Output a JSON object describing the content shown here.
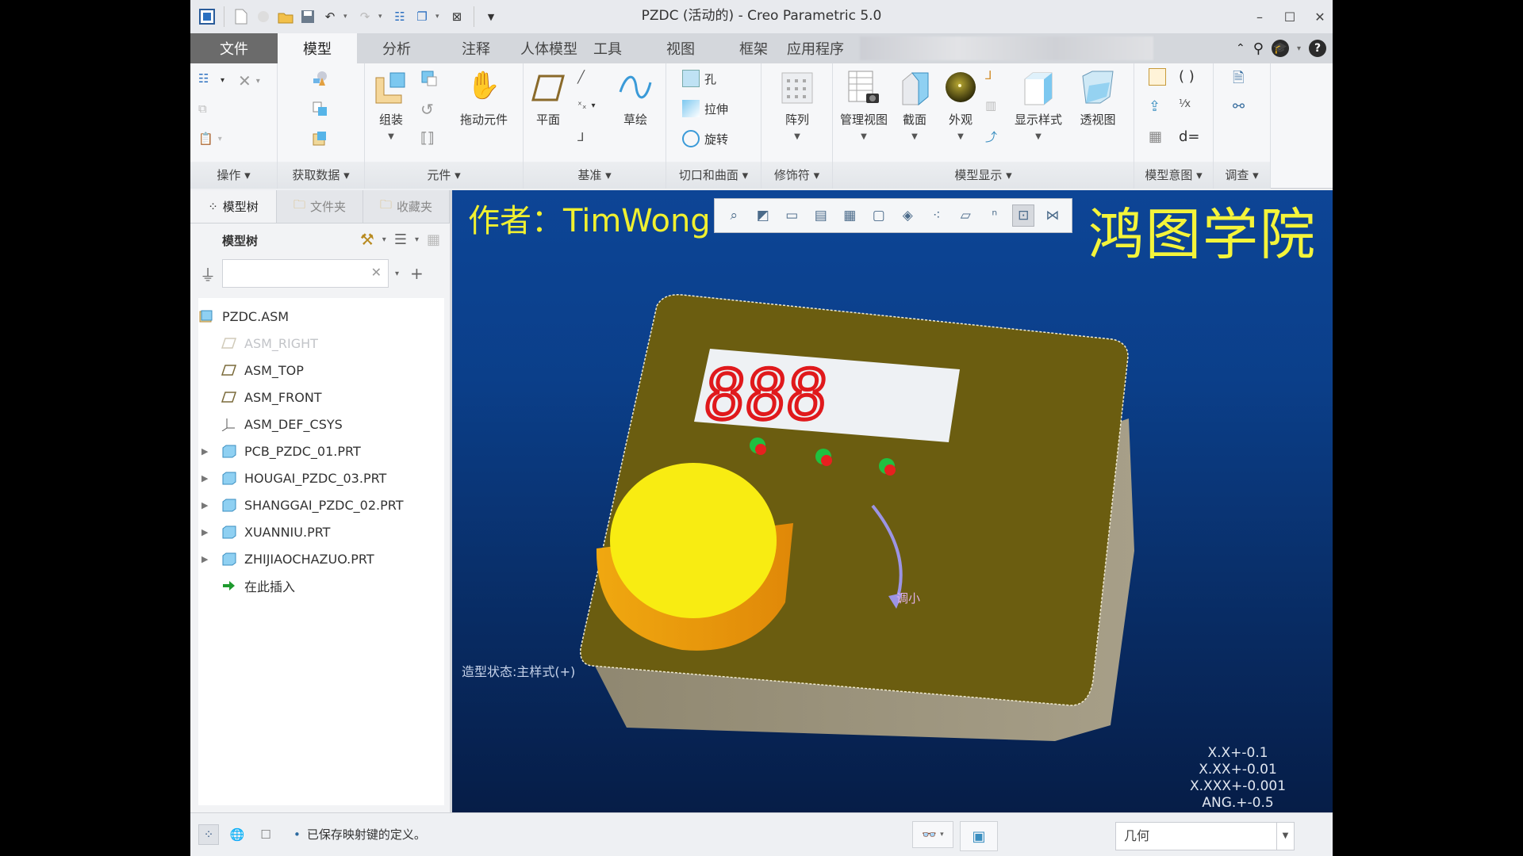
{
  "window": {
    "title": "PZDC (活动的) - Creo Parametric 5.0",
    "controls": {
      "minimize": "–",
      "maximize": "☐",
      "close": "✕"
    }
  },
  "quick_access": [
    "new-icon",
    "open-icon",
    "save-icon",
    "undo-icon",
    "redo-icon",
    "regenerate-icon",
    "windows-icon",
    "close-window-icon",
    "customize-icon"
  ],
  "tabs": [
    {
      "label": "文件"
    },
    {
      "label": "模型",
      "active": true
    },
    {
      "label": "分析"
    },
    {
      "label": "注释"
    },
    {
      "label": "人体模型"
    },
    {
      "label": "工具"
    },
    {
      "label": "视图"
    },
    {
      "label": "框架"
    },
    {
      "label": "应用程序"
    }
  ],
  "ribbon": {
    "groups": {
      "operations": "操作",
      "get_data": "获取数据",
      "component": "元件",
      "datum": "基准",
      "cut_surface": "切口和曲面",
      "modifiers": "修饰符",
      "model_display": "模型显示",
      "model_intent": "模型意图",
      "investigate": "调查"
    },
    "buttons": {
      "assemble": "组装",
      "drag_components": "拖动元件",
      "plane": "平面",
      "sketch": "草绘",
      "hole": "孔",
      "extrude": "拉伸",
      "revolve": "旋转",
      "pattern": "阵列",
      "manage_views": "管理视图",
      "section": "截面",
      "appearance": "外观",
      "display_style": "显示样式",
      "perspective": "透视图",
      "relations": "d="
    }
  },
  "left_panel": {
    "tabs": [
      {
        "label": "模型树",
        "active": true
      },
      {
        "label": "文件夹"
      },
      {
        "label": "收藏夹"
      }
    ],
    "header": "模型树",
    "search": {
      "value": "",
      "placeholder": ""
    },
    "tree": [
      {
        "label": "PZDC.ASM",
        "type": "assembly",
        "level": 0
      },
      {
        "label": "ASM_RIGHT",
        "type": "plane",
        "level": 1,
        "hidden": true
      },
      {
        "label": "ASM_TOP",
        "type": "plane",
        "level": 1
      },
      {
        "label": "ASM_FRONT",
        "type": "plane",
        "level": 1
      },
      {
        "label": "ASM_DEF_CSYS",
        "type": "csys",
        "level": 1
      },
      {
        "label": "PCB_PZDC_01.PRT",
        "type": "part",
        "level": 1,
        "expandable": true
      },
      {
        "label": "HOUGAI_PZDC_03.PRT",
        "type": "part",
        "level": 1,
        "expandable": true
      },
      {
        "label": "SHANGGAI_PZDC_02.PRT",
        "type": "part",
        "level": 1,
        "expandable": true
      },
      {
        "label": "XUANNIU.PRT",
        "type": "part",
        "level": 1,
        "expandable": true
      },
      {
        "label": "ZHIJIAOCHAZUO.PRT",
        "type": "part",
        "level": 1,
        "expandable": true
      },
      {
        "label": "在此插入",
        "type": "insert",
        "level": 1
      }
    ]
  },
  "graphics": {
    "author": "作者：TimWong",
    "brand": "鸿图学院",
    "model_state": "造型状态:主样式(+)",
    "display_digits": "888",
    "knob_labels": {
      "left": "调",
      "right": "调小"
    },
    "tolerances": [
      "X.X+-0.1",
      "X.XX+-0.01",
      "X.XXX+-0.001",
      "ANG.+-0.5"
    ],
    "view_toolbar": [
      "refit-icon",
      "zoom-in-icon",
      "zoom-out-icon",
      "repaint-icon",
      "saved-views-icon",
      "display-style-icon",
      "section-icon",
      "datum-display-icon",
      "plane-display-icon",
      "point-display-icon",
      "csys-display-icon",
      "annotation-display-icon"
    ]
  },
  "status": {
    "message": "已保存映射键的定义。",
    "filter": "几何"
  },
  "colors": {
    "viewport_top": "#0d4596",
    "viewport_bottom": "#061d47",
    "watermark": "#f0f030",
    "case": "#6b5d10",
    "knob": "#f8ec12",
    "digits": "#e0191c"
  }
}
